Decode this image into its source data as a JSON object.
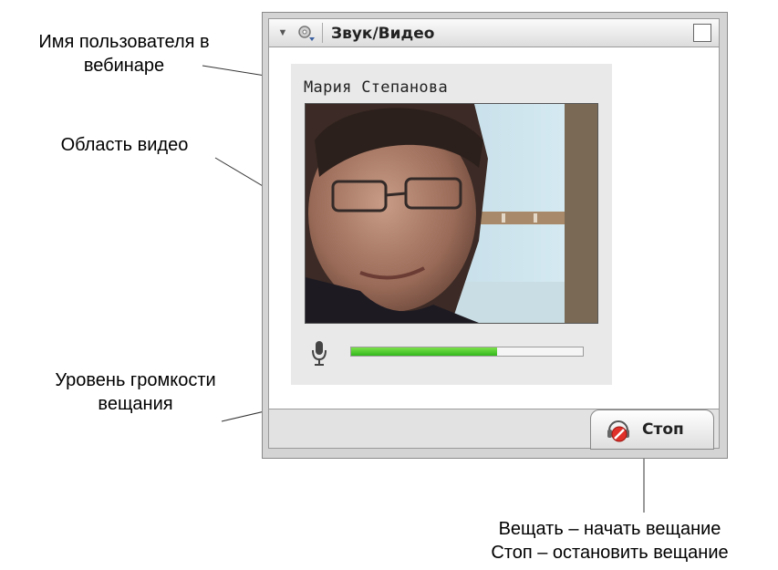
{
  "annotations": {
    "username": [
      "Имя пользователя в",
      "вебинаре"
    ],
    "video": "Область видео",
    "volume": [
      "Уровень громкости",
      "вещания"
    ],
    "button": [
      "Вещать – начать вещание",
      "Стоп – остановить вещание"
    ]
  },
  "panel": {
    "title": "Звук/Видео",
    "icons": {
      "collapse": "triangle-down-icon",
      "menu": "gear-dropdown-icon",
      "maximize": "maximize-icon"
    },
    "user_name": "Мария Степанова",
    "volume_level": 0.63,
    "volume_color": "#3cc428",
    "stop_label": "Стоп",
    "stop_icon": "stop-broadcast-icon"
  }
}
